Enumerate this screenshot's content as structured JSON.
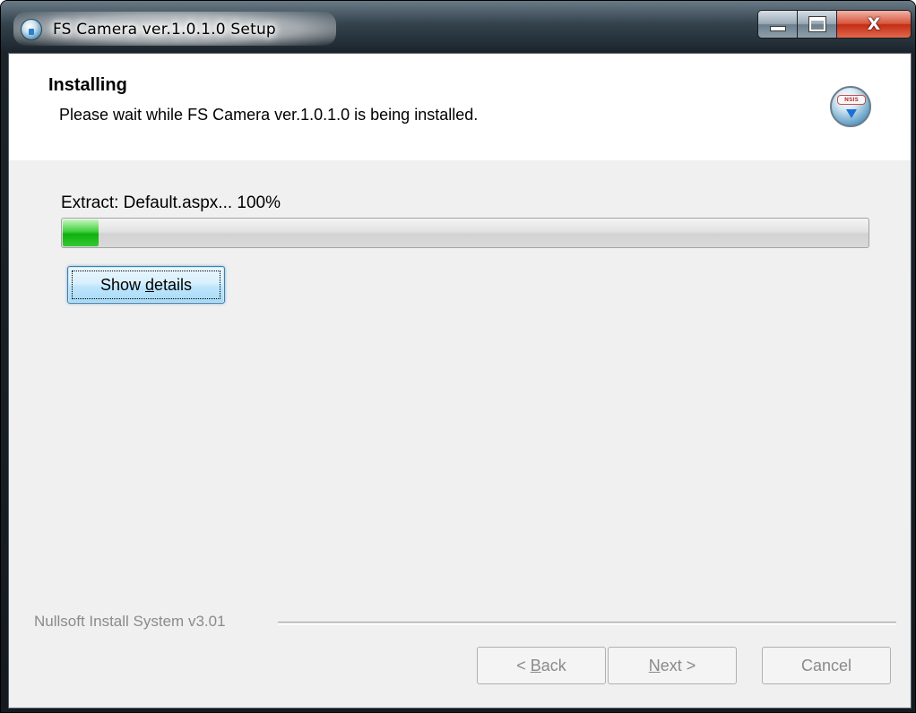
{
  "window": {
    "title": "FS Camera ver.1.0.1.0 Setup",
    "app_icon": "installer-globe-icon",
    "caption_buttons": {
      "minimize_icon": "minimize-icon",
      "maximize_icon": "maximize-icon",
      "close_icon": "close-icon",
      "close_glyph": "X"
    }
  },
  "header": {
    "title": "Installing",
    "subtitle": "Please wait while FS Camera ver.1.0.1.0 is being installed.",
    "icon": "nsis-installer-icon",
    "icon_badge": "NSIS"
  },
  "progress": {
    "status": "Extract: Default.aspx... 100%",
    "bar_fraction": 0.045,
    "bar_color": "#10b010"
  },
  "details_button": {
    "label_prefix": "Show ",
    "label_accel": "d",
    "label_suffix": "etails"
  },
  "footer": {
    "branding": "Nullsoft Install System v3.01",
    "back_prefix": "< ",
    "back_accel": "B",
    "back_suffix": "ack",
    "next_accel": "N",
    "next_suffix": "ext >",
    "cancel_label": "Cancel"
  }
}
